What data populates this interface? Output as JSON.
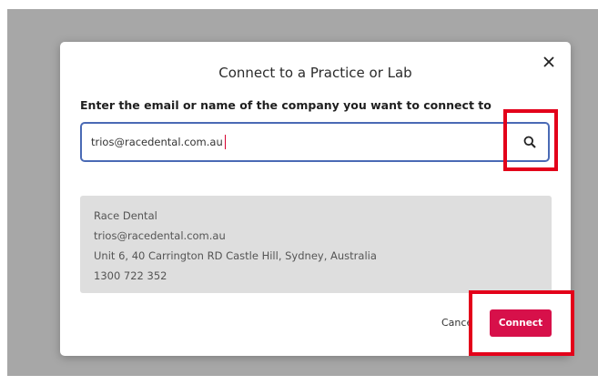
{
  "dialog": {
    "title": "Connect to a Practice or Lab",
    "close_icon": "close-icon",
    "prompt": "Enter the email or name of the company you want to connect to",
    "search": {
      "value": "trios@racedental.com.au",
      "icon": "search-icon"
    },
    "result": {
      "name": "Race Dental",
      "email": "trios@racedental.com.au",
      "address": "Unit 6, 40 Carrington RD Castle Hill, Sydney, Australia",
      "phone": "1300 722 352"
    },
    "cancel_label": "Cance",
    "connect_label": "Connect"
  },
  "colors": {
    "accent": "#d7104a",
    "input_border": "#4a6ab5",
    "highlight": "#e3001a",
    "card_bg": "#dedede"
  }
}
